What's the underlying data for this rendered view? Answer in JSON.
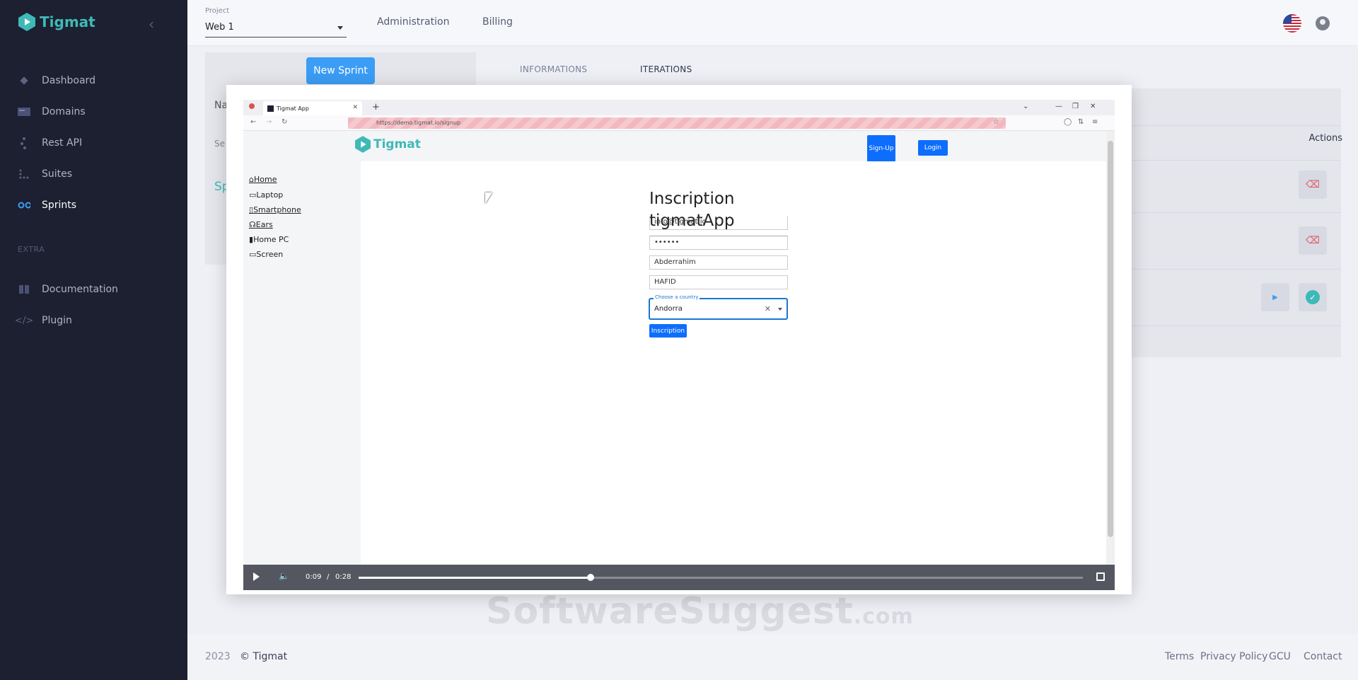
{
  "sidebar": {
    "brand": "Tigmat",
    "items": [
      {
        "label": "Dashboard"
      },
      {
        "label": "Domains"
      },
      {
        "label": "Rest API"
      },
      {
        "label": "Suites"
      },
      {
        "label": "Sprints"
      }
    ],
    "extra_section": "EXTRA",
    "extra_items": [
      {
        "label": "Documentation"
      },
      {
        "label": "Plugin"
      }
    ]
  },
  "topbar": {
    "project_label": "Project",
    "project_value": "Web 1",
    "links": [
      "Administration",
      "Billing"
    ]
  },
  "content": {
    "new_sprint_button": "New Sprint",
    "tabs": [
      "INFORMATIONS",
      "ITERATIONS"
    ],
    "actions_header": "Actions",
    "partial_na": "Na",
    "partial_se": "Se",
    "partial_sp": "Sp"
  },
  "footer": {
    "year": "2023",
    "copyright": "© Tigmat",
    "links": [
      "Terms",
      "Privacy Policy",
      "GCU",
      "Contact"
    ]
  },
  "watermark": {
    "main": "SoftwareSuggest",
    "suffix": ".com"
  },
  "video": {
    "browser": {
      "tab_title": "Tigmat App",
      "url": "https://demo.tigmat.io/signup"
    },
    "app": {
      "logo": "Tigmat",
      "signup_button": "Sign-Up",
      "login_button": "Login",
      "side_items": [
        "Home",
        "Laptop",
        "Smartphone",
        "Ears",
        "Home PC",
        "Screen"
      ],
      "form_title_line1": "Inscription",
      "form_title_line2": "tigmatApp",
      "email": "info@tigmat.io",
      "password": "••••••",
      "first_name": "Abderrahim",
      "last_name": "HAFID",
      "country_label": "Choose a country",
      "country_value": "Andorra",
      "submit_button": "Inscription"
    },
    "controls": {
      "current_time": "0:09",
      "separator": "/",
      "duration": "0:28",
      "progress_fraction": 0.32
    }
  }
}
